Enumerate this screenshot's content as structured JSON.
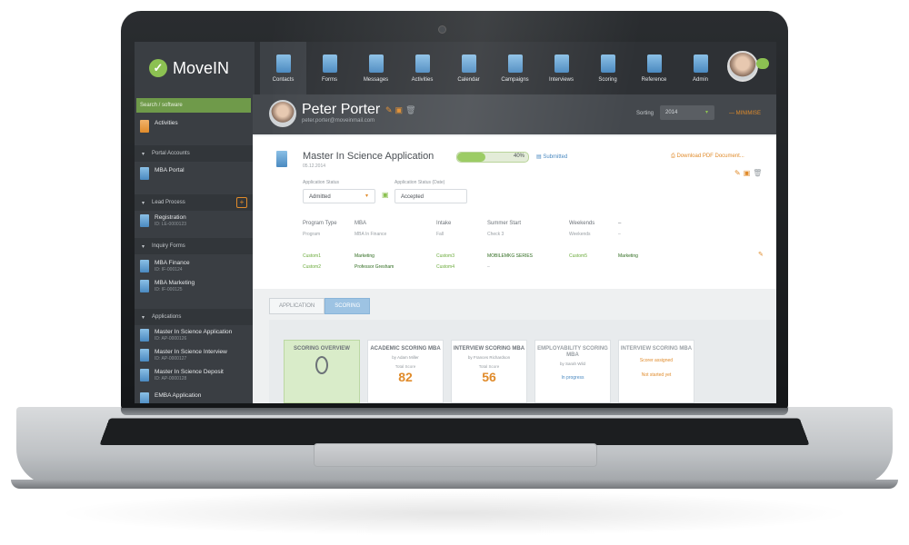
{
  "app": {
    "logo_text": "MoveIN",
    "logo_mark": "✓"
  },
  "nav": [
    {
      "label": "Contacts",
      "icon": "contacts-icon",
      "active": true
    },
    {
      "label": "Forms",
      "icon": "forms-icon"
    },
    {
      "label": "Messages",
      "icon": "messages-icon"
    },
    {
      "label": "Activities",
      "icon": "activities-icon"
    },
    {
      "label": "Calendar",
      "icon": "calendar-icon"
    },
    {
      "label": "Campaigns",
      "icon": "campaigns-icon"
    },
    {
      "label": "Interviews",
      "icon": "interviews-icon"
    },
    {
      "label": "Scoring",
      "icon": "scoring-icon"
    },
    {
      "label": "Reference",
      "icon": "reference-icon"
    },
    {
      "label": "Admin",
      "icon": "admin-icon"
    }
  ],
  "sidebar": {
    "search_placeholder": "Search / software",
    "activities": "Activities",
    "sections": [
      {
        "label": "Portal Accounts"
      },
      {
        "label": "Lead Process"
      },
      {
        "label": "Inquiry Forms"
      },
      {
        "label": "Applications"
      }
    ],
    "items": {
      "portal": "MBA Portal",
      "lead": {
        "label": "Registration",
        "sub": "ID: LE-0000123"
      },
      "inquiry": [
        {
          "label": "MBA Finance",
          "sub": "ID: IF-000124"
        },
        {
          "label": "MBA Marketing",
          "sub": "ID: IF-000125"
        }
      ],
      "applications": [
        {
          "label": "Master In Science Application",
          "sub": "ID: AP-0000126"
        },
        {
          "label": "Master In Science Interview",
          "sub": "ID: AP-0000127"
        },
        {
          "label": "Master In Science Deposit",
          "sub": "ID: AP-0000128"
        },
        {
          "label": "EMBA Application",
          "sub": ""
        }
      ]
    }
  },
  "contact": {
    "name": "Peter Porter",
    "email": "peter.porter@moveinmail.com",
    "sorting_label": "Sorting",
    "sorting_value": "2014",
    "minimise": "— MINIMISE"
  },
  "application": {
    "title": "Master In Science Application",
    "date": "05.12.2014",
    "progress_text": "40%",
    "progress": 0.4,
    "status": "Submitted",
    "download": "Download PDF Document...",
    "app_status_label": "Application Status",
    "app_status_value": "Admitted",
    "app_status_date_label": "Application Status (Date)",
    "app_status_date_value": "Accepted",
    "fields": [
      {
        "h": "Program Type",
        "v": "Program"
      },
      {
        "h": "MBA",
        "v": "MBA In Finance"
      },
      {
        "h": "Intake",
        "v": "Fall"
      },
      {
        "h": "Summer Start",
        "v": "Check 3"
      },
      {
        "h": "Weekends",
        "v": "Weekends"
      },
      {
        "h": "–",
        "v": "–"
      }
    ],
    "custom_row1": [
      "Custom1",
      "Marketing",
      "Custom3",
      "MOBILEMKG SERIES",
      "Custom5",
      "Marketing"
    ],
    "custom_row2": [
      "Custom2",
      "Professor Gresham",
      "Custom4",
      "–"
    ]
  },
  "tabs": [
    {
      "label": "APPLICATION"
    },
    {
      "label": "SCORING",
      "active": true
    }
  ],
  "scoring": [
    {
      "title": "SCORING OVERVIEW",
      "type": "overview"
    },
    {
      "title": "ACADEMIC SCORING MBA",
      "by": "by Adam Miller",
      "total_label": "Total Score",
      "total": "82"
    },
    {
      "title": "INTERVIEW SCORING MBA",
      "by": "by Frances Richardson",
      "total_label": "Total Score",
      "total": "56"
    },
    {
      "title": "EMPLOYABILITY SCORING MBA",
      "by": "by Sarah Wild",
      "link": "In progress"
    },
    {
      "title": "INTERVIEW SCORING MBA",
      "orange1": "Scorer assigned",
      "orange2": "Not started yet"
    }
  ],
  "colors": {
    "accent": "#e08b2b",
    "brand_green": "#8cc152",
    "link_blue": "#4a89c0",
    "topbar": "#2e3135"
  }
}
